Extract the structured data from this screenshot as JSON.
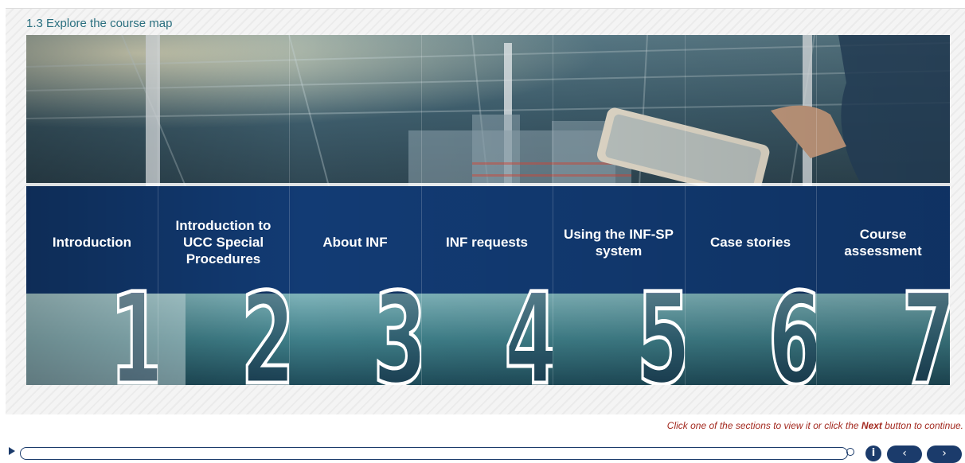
{
  "slide": {
    "title": "1.3 Explore the course map"
  },
  "sections": [
    {
      "label": "Introduction",
      "number": "1"
    },
    {
      "label": "Introduction to UCC Special Procedures",
      "number": "2"
    },
    {
      "label": "About INF",
      "number": "3"
    },
    {
      "label": "INF requests",
      "number": "4"
    },
    {
      "label": "Using the INF-SP system",
      "number": "5"
    },
    {
      "label": "Case stories",
      "number": "6"
    },
    {
      "label": "Course assessment",
      "number": "7"
    }
  ],
  "instruction": {
    "before": "Click one of the sections to view it or click the ",
    "emphasis": "Next",
    "after": " button to continue."
  },
  "player": {
    "info_label": "i",
    "prev_label": "‹",
    "next_label": "›"
  },
  "colors": {
    "band": "#123b74",
    "title": "#2a6f7f",
    "instruction": "#a3291f",
    "player": "#1b3b6b"
  },
  "icons": [
    "play-icon",
    "info-icon",
    "chevron-left-icon",
    "chevron-right-icon"
  ]
}
